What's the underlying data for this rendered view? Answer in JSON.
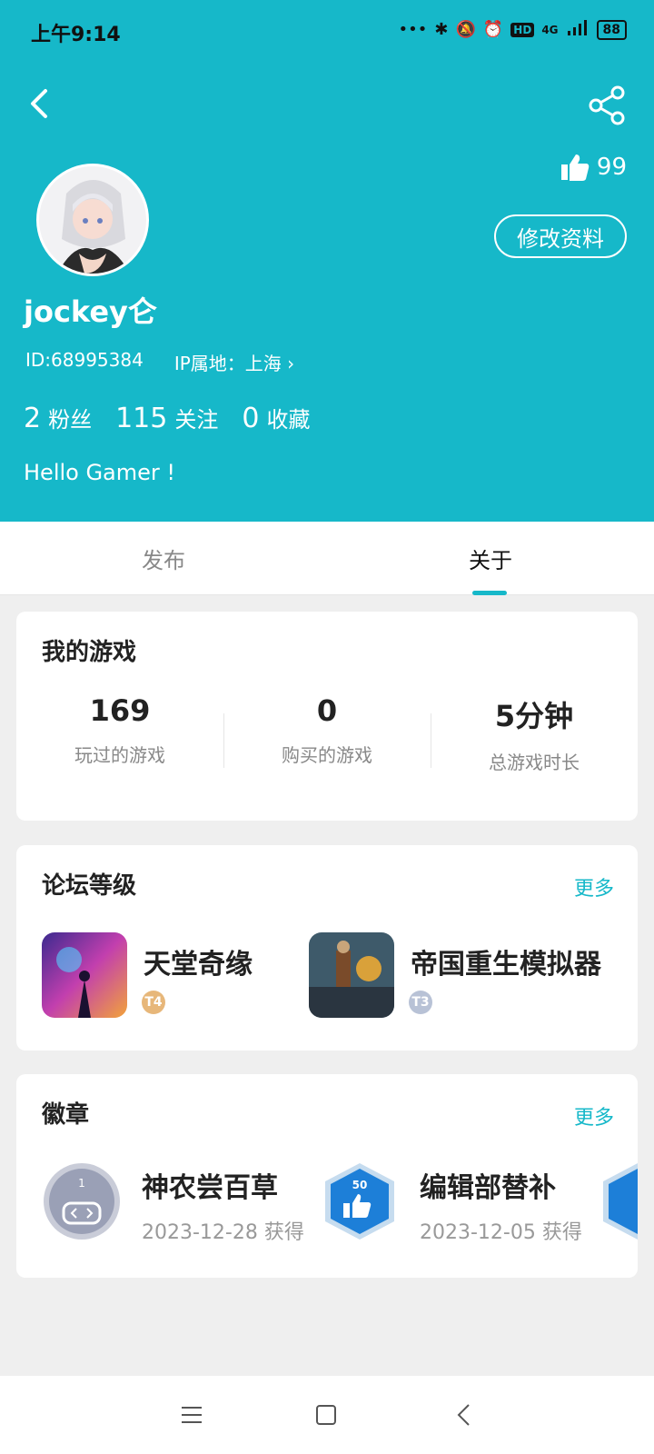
{
  "status_bar": {
    "time": "上午9:14",
    "network": "4G",
    "battery": "88"
  },
  "header": {
    "likes": "99",
    "edit_label": "修改资料",
    "username": "jockey仑",
    "id": "ID:68995384",
    "ip_location": "IP属地：上海 ›",
    "stats": [
      {
        "value": "2",
        "label": "粉丝"
      },
      {
        "value": "115",
        "label": "关注"
      },
      {
        "value": "0",
        "label": "收藏"
      }
    ],
    "bio": "Hello Gamer !"
  },
  "tabs": [
    {
      "label": "发布",
      "active": false
    },
    {
      "label": "关于",
      "active": true
    }
  ],
  "my_games": {
    "title": "我的游戏",
    "stats": [
      {
        "value": "169",
        "label": "玩过的游戏"
      },
      {
        "value": "0",
        "label": "购买的游戏"
      },
      {
        "value": "5分钟",
        "label": "总游戏时长"
      }
    ]
  },
  "forum_level": {
    "title": "论坛等级",
    "more": "更多",
    "items": [
      {
        "name": "天堂奇缘",
        "level": "T4"
      },
      {
        "name": "帝国重生模拟器",
        "level": "T3"
      }
    ]
  },
  "badges": {
    "title": "徽章",
    "more": "更多",
    "items": [
      {
        "name": "神农尝百草",
        "date": "2023-12-28 获得",
        "number": "1"
      },
      {
        "name": "编辑部替补",
        "date": "2023-12-05 获得",
        "number": "50"
      }
    ]
  },
  "colors": {
    "accent": "#16b8c9",
    "background": "#efefef"
  }
}
